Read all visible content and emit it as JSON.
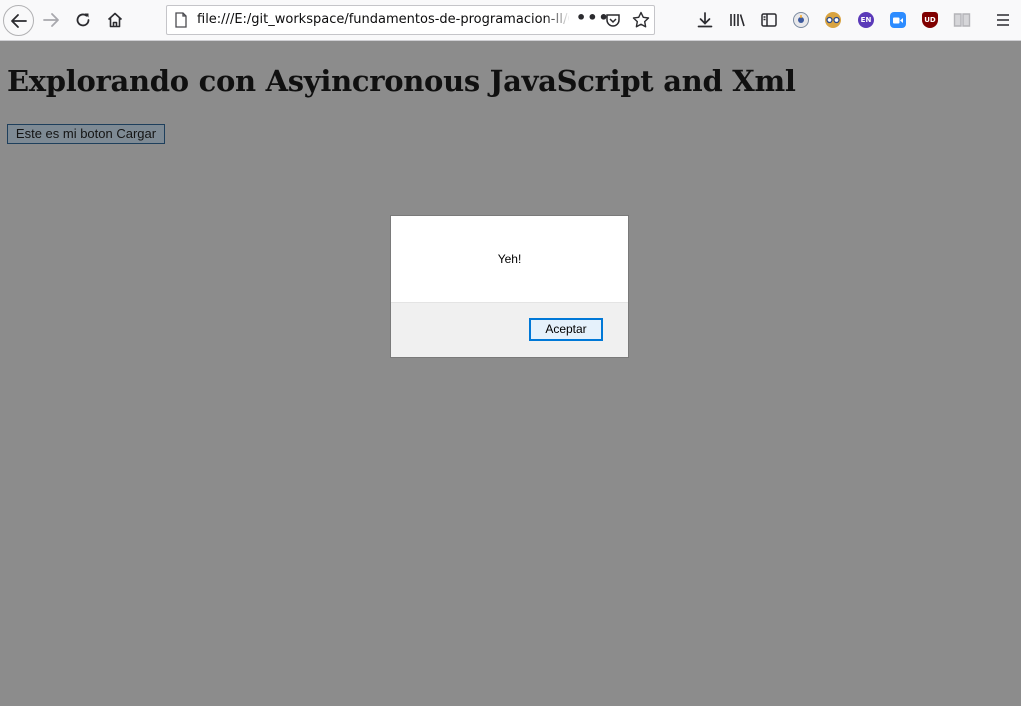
{
  "browser": {
    "url": "file:///E:/git_workspace/fundamentos-de-programacion-II/Cla",
    "toolbar_icons": [
      "back-icon",
      "forward-icon",
      "reload-icon",
      "home-icon",
      "page-info-icon",
      "page-actions-icon",
      "pocket-icon",
      "bookmark-star-icon",
      "download-icon",
      "library-icon",
      "sidebar-icon",
      "extension-icon",
      "reader-glasses-icon",
      "translate-icon",
      "zoom-icon",
      "ublock-icon",
      "reader-view-icon",
      "menu-icon"
    ],
    "extensions": {
      "en_label": "EN",
      "ublock_label": "UD"
    },
    "colors": {
      "toolbar_bg": "#f9f9fa",
      "translate": "#5b3ab9",
      "zoom": "#2d8cff",
      "ublock": "#800000"
    }
  },
  "page": {
    "heading": "Explorando con Asyincronous JavaScript and Xml",
    "load_button_label": "Este es mi boton Cargar",
    "overlay_color": "#8c8c8c"
  },
  "dialog": {
    "message": "Yeh!",
    "ok_label": "Aceptar",
    "accent": "#0078d7"
  }
}
